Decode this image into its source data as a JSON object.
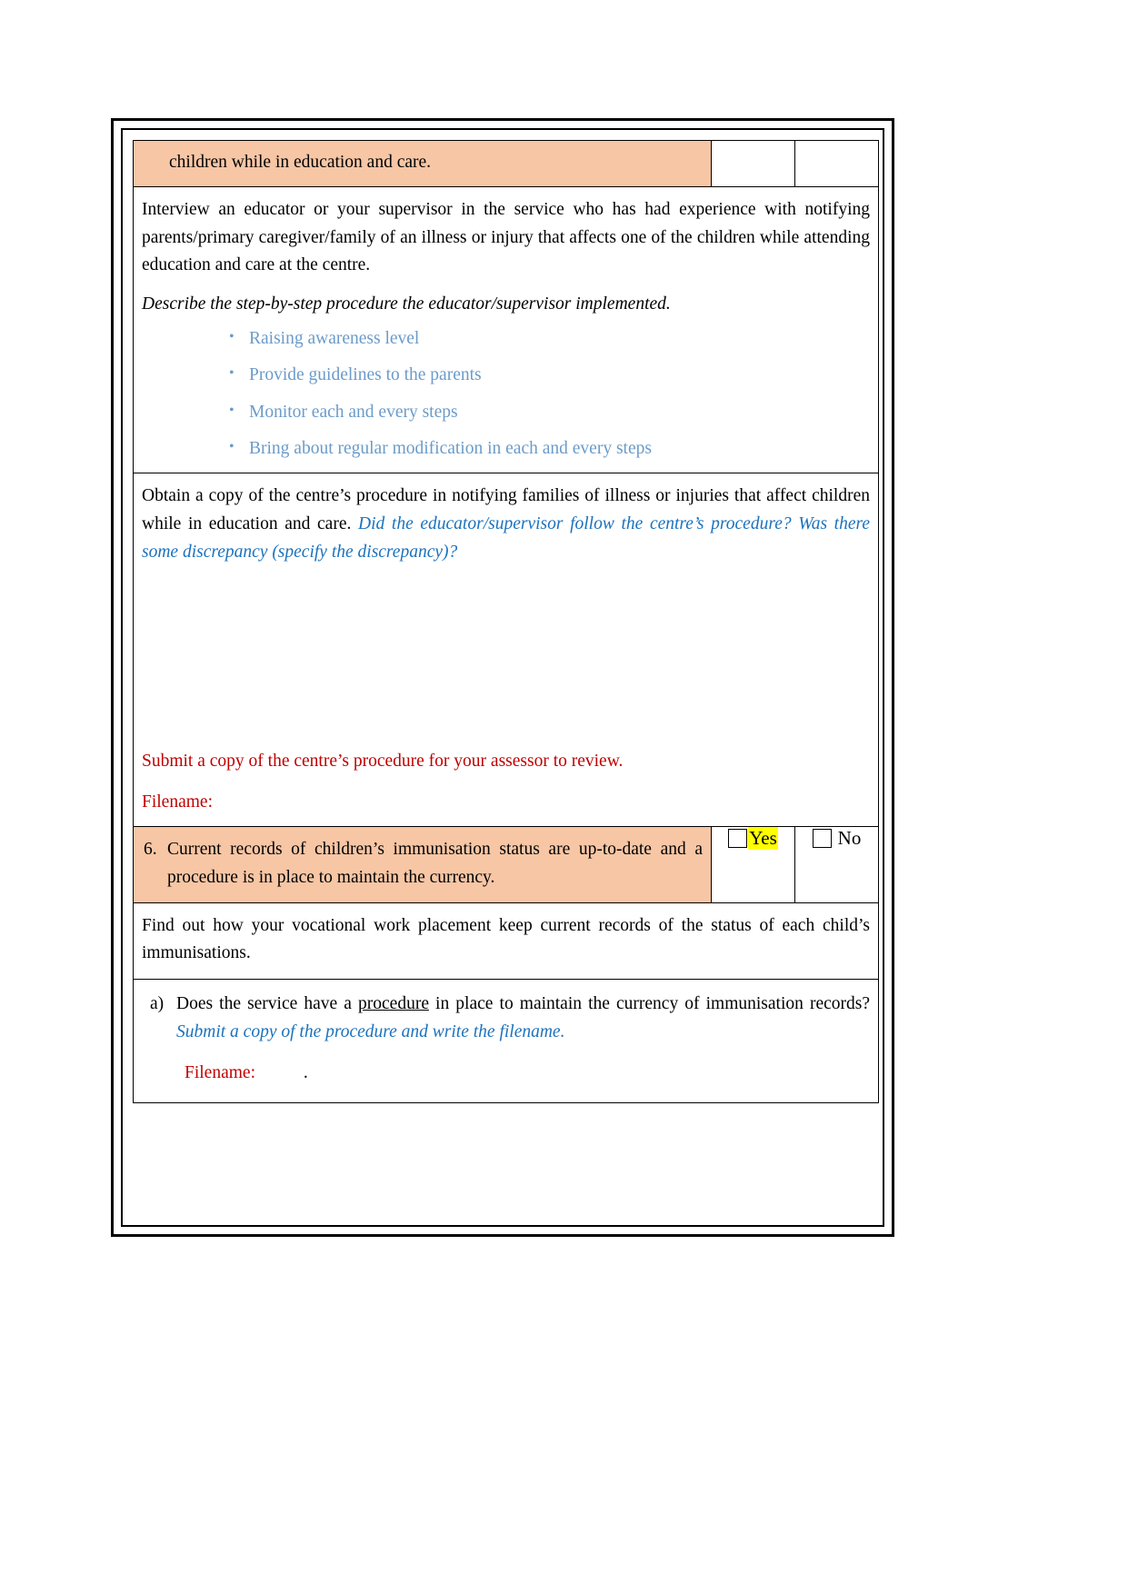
{
  "document": {
    "rows": {
      "header_shaded": {
        "text": "children while in education and care."
      },
      "interview_block": {
        "paragraph": "Interview an educator or your supervisor in the service who has had experience with notifying parents/primary caregiver/family of an illness or injury that affects one of the children while attending education and care at the centre.",
        "instruction_italic": "Describe the step-by-step procedure the educator/supervisor implemented.",
        "answer_bullets": [
          "Raising awareness level",
          "Provide guidelines to the parents",
          "Monitor each and every steps",
          "Bring about regular modification in each and every steps"
        ],
        "bullet_glyph": "•"
      },
      "obtain_copy_block": {
        "paragraph_black": "Obtain a copy of the centre’s procedure in notifying families of illness or injuries that affect children while in education and care.",
        "paragraph_blue_italic": "Did the educator/supervisor follow the centre’s procedure? Was there some discrepancy (specify the discrepancy)?",
        "submit_note_red": "Submit a copy of the centre’s procedure for your assessor to review.",
        "filename_label_red": "Filename:"
      },
      "question_6": {
        "number": "6.",
        "text": "Current records of children’s immunisation status are up-to-date and a procedure is in place to maintain the currency.",
        "yes_label": "Yes",
        "yes_highlighted": true,
        "yes_checked": false,
        "no_label": "No",
        "no_checked": false
      },
      "find_out_block": {
        "paragraph": "Find out how your vocational work placement keep current records of the status of each child’s immunisations."
      },
      "item_a": {
        "letter": "a)",
        "text_part1": "Does the service have a ",
        "text_underlined": "procedure",
        "text_part2": " in place to maintain the currency of immunisation records? ",
        "text_blue_italic": "Submit a copy of the procedure and write the filename.",
        "filename_label_red": "Filename:",
        "filename_value": "."
      }
    }
  },
  "colors": {
    "shaded_row": "#F7C6A5",
    "blue_italic": "#1B72BD",
    "blue_light_bullets": "#6B9BC9",
    "red": "#C00000",
    "highlight_yellow": "#FFFF00",
    "border": "#000000"
  }
}
